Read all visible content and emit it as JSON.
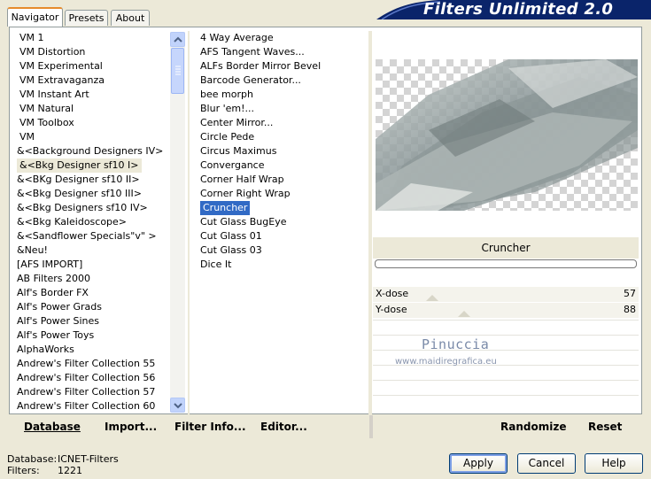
{
  "tabs": [
    {
      "label": "Navigator"
    },
    {
      "label": "Presets"
    },
    {
      "label": "About"
    }
  ],
  "app_title": "Filters Unlimited 2.0",
  "categories": [
    "VM 1",
    "VM Distortion",
    "VM Experimental",
    "VM Extravaganza",
    "VM Instant Art",
    "VM Natural",
    "VM Toolbox",
    "VM",
    "&<Background Designers IV>",
    "&<Bkg Designer sf10 I>",
    "&<BKg Designer sf10 II>",
    "&<Bkg Designer sf10 III>",
    "&<Bkg Designers sf10 IV>",
    "&<Bkg Kaleidoscope>",
    "&<Sandflower Specials\"v\" >",
    "&Neu!",
    "[AFS IMPORT]",
    "AB Filters 2000",
    "Alf's Border FX",
    "Alf's Power Grads",
    "Alf's Power Sines",
    "Alf's Power Toys",
    "AlphaWorks",
    "Andrew's Filter Collection 55",
    "Andrew's Filter Collection 56",
    "Andrew's Filter Collection 57",
    "Andrew's Filter Collection 60"
  ],
  "selected_category": "&<Bkg Designer sf10 I>",
  "filters": [
    "4 Way Average",
    "AFS Tangent Waves...",
    "ALFs Border Mirror Bevel",
    "Barcode Generator...",
    "bee morph",
    "Blur 'em!...",
    "Center Mirror...",
    "Circle Pede",
    "Circus Maximus",
    "Convergance",
    "Corner Half Wrap",
    "Corner Right Wrap",
    "Cruncher",
    "Cut Glass  BugEye",
    "Cut Glass 01",
    "Cut Glass 03",
    "Dice It"
  ],
  "selected_filter": "Cruncher",
  "filter_title": "Cruncher",
  "sliders": [
    {
      "label": "X-dose",
      "value": "57",
      "level": 57
    },
    {
      "label": "Y-dose",
      "value": "88",
      "level": 88
    }
  ],
  "watermark": {
    "line1": "Pinuccia",
    "line2": "www.maidiregrafica.eu"
  },
  "commands": {
    "database": "Database",
    "import": "Import...",
    "filter_info": "Filter Info...",
    "editor": "Editor...",
    "randomize": "Randomize",
    "reset": "Reset"
  },
  "status": {
    "database_label": "Database:",
    "database_value": "ICNET-Filters",
    "filters_label": "Filters:",
    "filters_value": "1221"
  },
  "buttons": {
    "apply": "Apply",
    "cancel": "Cancel",
    "help": "Help"
  },
  "colors": {
    "selection": "#316ac5",
    "banner": "#0a246a",
    "tab_accent": "#e68b2c"
  },
  "icons": {
    "scroll_up": "chevron-up-icon",
    "scroll_down": "chevron-down-icon"
  }
}
